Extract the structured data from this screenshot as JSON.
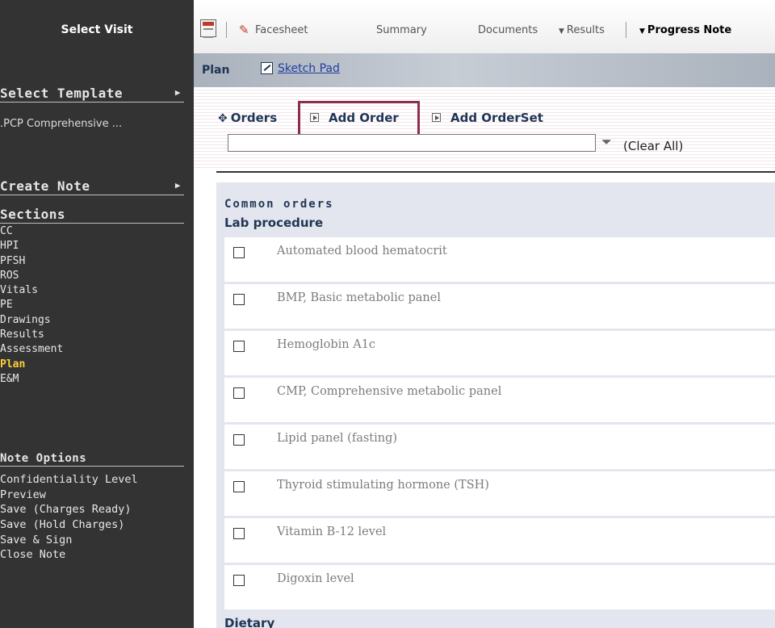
{
  "sidebar": {
    "select_visit": "Select Visit",
    "select_template": "Select Template",
    "template_item": ".PCP Comprehensive ...",
    "create_note": "Create Note",
    "sections_heading": "Sections",
    "sections": [
      "CC",
      "HPI",
      "PFSH",
      "ROS",
      "Vitals",
      "PE",
      "Drawings",
      "Results",
      "Assessment",
      "Plan",
      "E&M"
    ],
    "active_section": "Plan",
    "note_options_heading": "Note Options",
    "note_options": [
      "Confidentiality Level",
      "Preview",
      "Save (Charges Ready)",
      "Save (Hold Charges)",
      "Save & Sign",
      "Close Note"
    ],
    "arrow_icon": "right-triangle-icon"
  },
  "toolbar": {
    "facesheet": "Facesheet",
    "summary": "Summary",
    "documents": "Documents",
    "results": "Results",
    "progress_note": "Progress Note"
  },
  "plan": {
    "title": "Plan",
    "sketch_pad": "Sketch Pad"
  },
  "orders": {
    "orders_label": "Orders",
    "add_order": "Add Order",
    "add_orderset": "Add OrderSet",
    "search_value": "",
    "clear_all": "(Clear All)",
    "common_orders": "Common orders",
    "lab_procedure": "Lab procedure",
    "items": [
      "Automated blood hematocrit",
      "BMP, Basic metabolic panel",
      "Hemoglobin A1c",
      "CMP, Comprehensive metabolic panel",
      "Lipid panel (fasting)",
      "Thyroid stimulating hormone (TSH)",
      "Vitamin B-12 level",
      "Digoxin level"
    ],
    "dietary": "Dietary"
  },
  "colors": {
    "sidebar_bg": "#333333",
    "active_section": "#ffd23a",
    "heading_blue": "#1f3554",
    "highlight_frame": "#8b2f4e"
  }
}
